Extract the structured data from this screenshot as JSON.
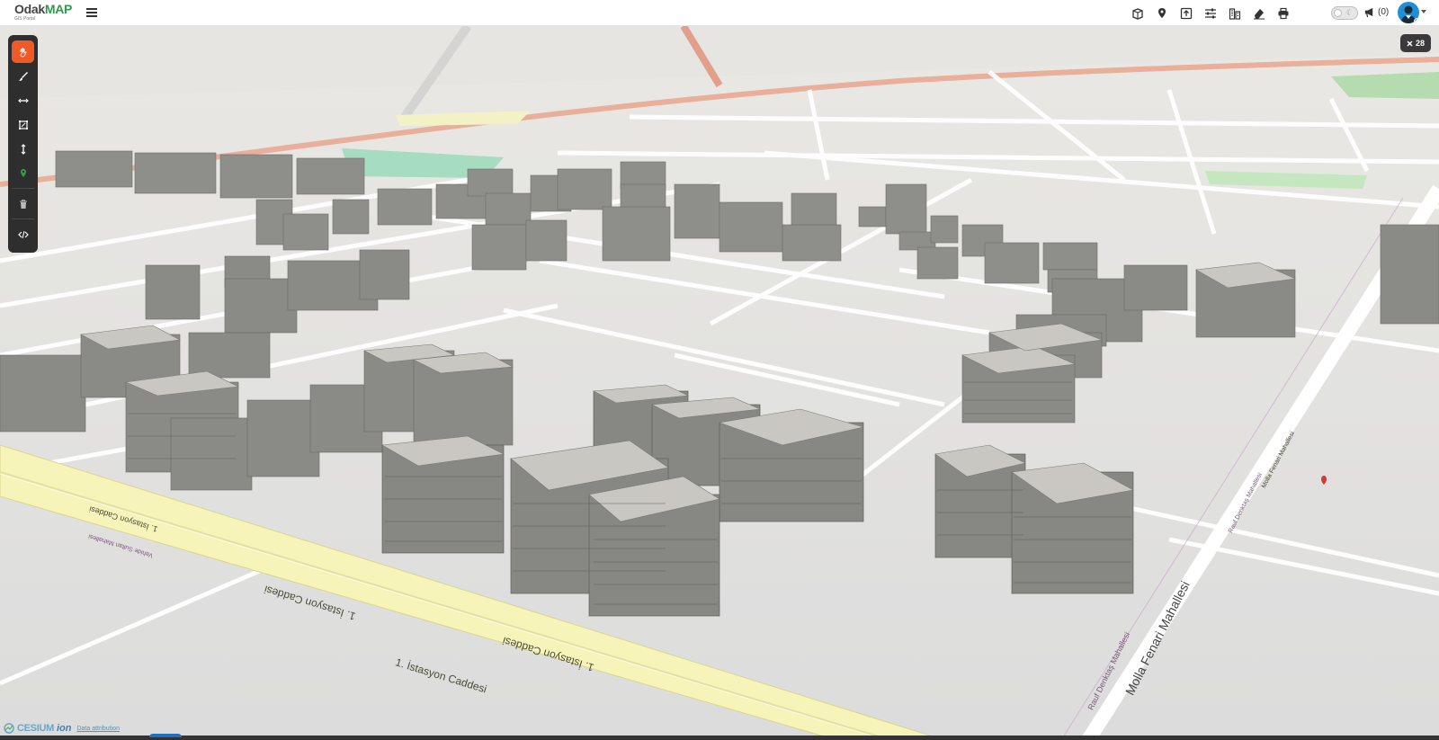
{
  "header": {
    "logo_main_a": "Odak",
    "logo_main_b": "MAP",
    "logo_sub": "GIS Portal",
    "notifications_count": "(0)",
    "toolbar_icons": [
      "layers-3d-icon",
      "location-pin-icon",
      "upload-icon",
      "sliders-icon",
      "building-grid-icon",
      "eraser-icon",
      "printer-icon"
    ]
  },
  "tools": [
    {
      "name": "pan-hand-icon",
      "active": true
    },
    {
      "name": "draw-brush-icon",
      "active": false
    },
    {
      "name": "measure-distance-icon",
      "active": false
    },
    {
      "name": "measure-area-icon",
      "active": false
    },
    {
      "name": "measure-height-icon",
      "active": false
    },
    {
      "name": "location-marker-icon",
      "active": false
    },
    {
      "name": "trash-icon",
      "active": false
    },
    {
      "name": "code-icon",
      "active": false
    }
  ],
  "badge": {
    "icon": "close-x-icon",
    "count": "28"
  },
  "map": {
    "streets": [
      "1. İstasyon Caddesi",
      "1. İstasyon Caddesi",
      "1. İstasyon Caddesi",
      "1. İstasyon Caddesi",
      "Molla Fenari Mahallesi",
      "Rauf Denktaş Mahallesi",
      "Molla Fenari Mahallesi",
      "Rauf Denktaş Mahallesi",
      "Vahide Sultan Mahallesi"
    ]
  },
  "footer": {
    "cesium_text": "CESIUM",
    "ion_text": "ion",
    "credits_text": "Data attribution"
  },
  "colors": {
    "accent": "#f05a28",
    "brand_green": "#2e9b4a",
    "road_main": "#f6f4b8",
    "building": "#8e8e8a"
  }
}
